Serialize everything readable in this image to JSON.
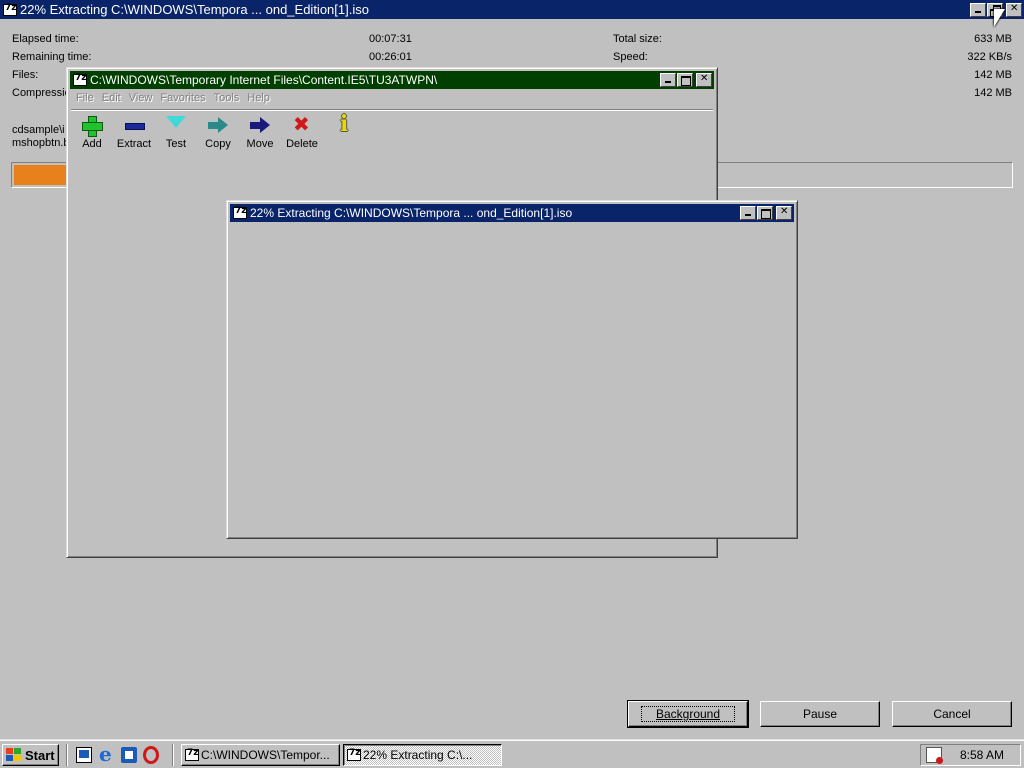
{
  "main_window": {
    "title": "22% Extracting C:\\WINDOWS\\Tempora ... ond_Edition[1].iso",
    "stats": {
      "elapsed_label": "Elapsed time:",
      "elapsed_value": "00:07:31",
      "remaining_label": "Remaining time:",
      "remaining_value": "00:26:01",
      "files_label": "Files:",
      "files_value": "142 MB",
      "compression_label": "Compressio",
      "compression_value": "142 MB",
      "total_size_label": "Total size:",
      "total_size_value": "633 MB",
      "speed_label": "Speed:",
      "speed_value": "322 KB/s"
    },
    "current_files": [
      "cdsample\\i",
      "mshopbtn.b"
    ],
    "progress_percent": 22,
    "progress_color": "#e8801c",
    "buttons": {
      "background": "Background",
      "pause": "Pause",
      "cancel": "Cancel"
    }
  },
  "file_manager": {
    "title": "C:\\WINDOWS\\Temporary Internet Files\\Content.IE5\\TU3ATWPN\\",
    "menu": [
      "File",
      "Edit",
      "View",
      "Favorites",
      "Tools",
      "Help"
    ],
    "toolbar": [
      {
        "label": "Add",
        "icon": "add-icon"
      },
      {
        "label": "Extract",
        "icon": "extract-icon"
      },
      {
        "label": "Test",
        "icon": "test-icon"
      },
      {
        "label": "Copy",
        "icon": "copy-icon"
      },
      {
        "label": "Move",
        "icon": "move-icon"
      },
      {
        "label": "Delete",
        "icon": "delete-icon"
      },
      {
        "label": "",
        "icon": "info-icon"
      }
    ]
  },
  "progress_dialog": {
    "title": "22% Extracting C:\\WINDOWS\\Tempora ... ond_Edition[1].iso"
  },
  "taskbar": {
    "start_label": "Start",
    "tasks": [
      {
        "label": "C:\\WINDOWS\\Tempor..."
      },
      {
        "label": "22% Extracting C:\\..."
      }
    ],
    "clock": "8:58 AM"
  },
  "colors": {
    "active_title": "#0a246a",
    "file_manager_title": "#003f00",
    "window_face": "#c0c0c0"
  }
}
